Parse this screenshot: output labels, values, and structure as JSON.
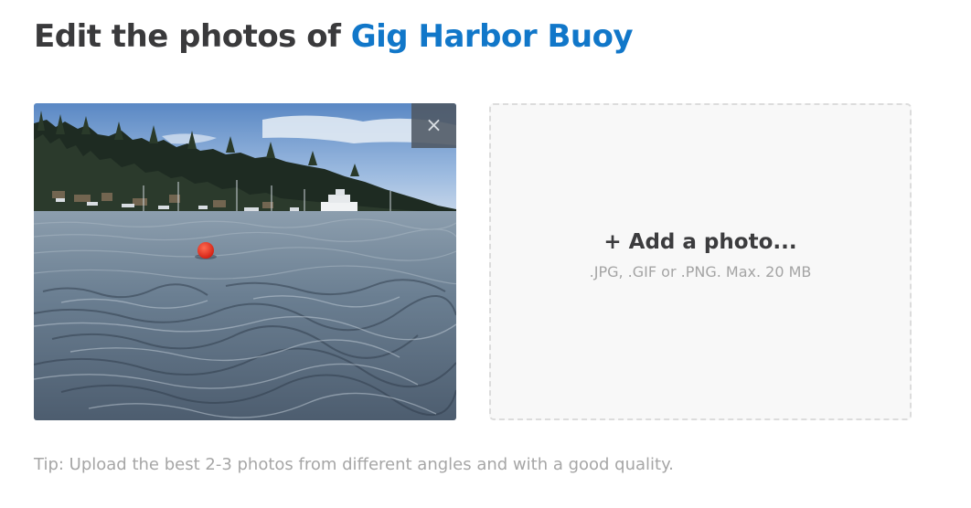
{
  "title": {
    "prefix": "Edit the photos of ",
    "place_name": "Gig Harbor Buoy"
  },
  "photo": {
    "remove_label": "×",
    "icons": [
      "close-icon"
    ]
  },
  "upload": {
    "add_label": "+ Add a photo...",
    "hint": ".JPG, .GIF or .PNG. Max. 20 MB"
  },
  "tip": "Tip: Upload the best 2-3 photos from different angles and with a good quality.",
  "colors": {
    "accent": "#1177c9",
    "title_text": "#3a3a3c",
    "muted_text": "#a6a6a6",
    "drop_zone_bg": "#f8f8f8",
    "drop_zone_border": "#dcdcdc",
    "remove_button_bg": "#4e5863"
  }
}
